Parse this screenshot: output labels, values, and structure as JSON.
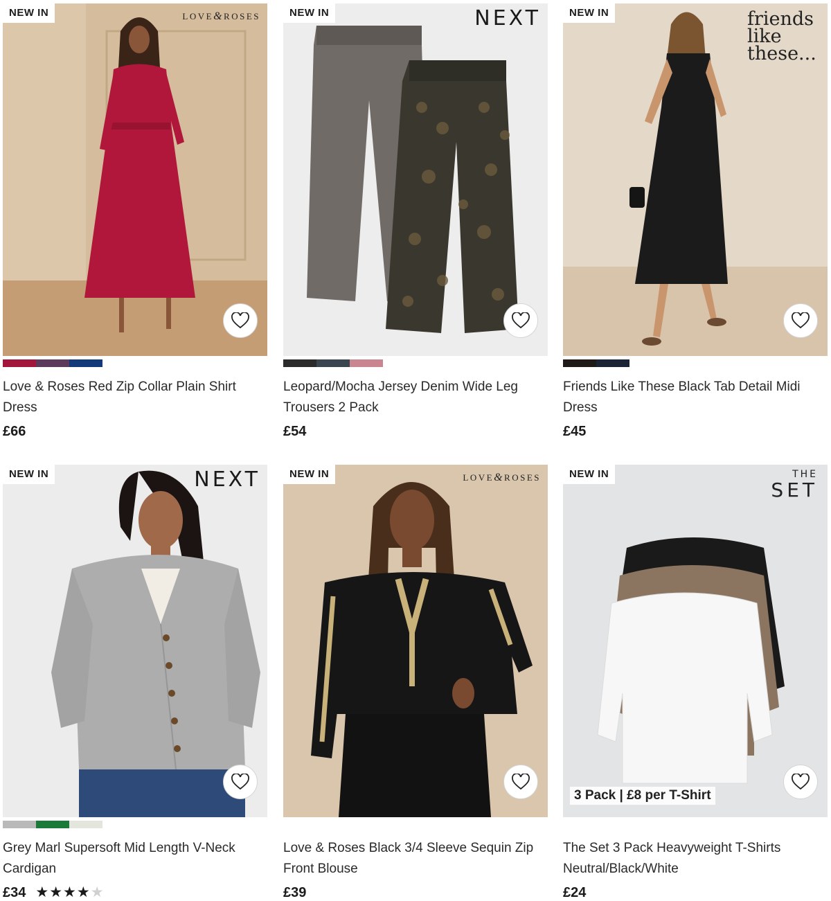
{
  "products": [
    {
      "badge": "NEW IN",
      "brand": "LOVE & ROSES",
      "title": "Love & Roses Red Zip Collar Plain Shirt Dress",
      "price": "£66",
      "swatches": [
        "#a3163c",
        "#5c3a5e",
        "#123a7a"
      ],
      "image_colors": {
        "bg": "#d9c3a6",
        "floor": "#c6a27a",
        "garment": "#b0173a"
      }
    },
    {
      "badge": "NEW IN",
      "brand": "NEXT",
      "title": "Leopard/Mocha Jersey Denim Wide Leg Trousers 2 Pack",
      "price": "£54",
      "swatches": [
        "#2b2b2b",
        "#3a4550",
        "#c98590"
      ],
      "image_colors": {
        "bg": "#ececec",
        "garment": "#6f6a66",
        "garment2": "#3b3a30"
      }
    },
    {
      "badge": "NEW IN",
      "brand": "friends like these...",
      "title": "Friends Like These Black Tab Detail Midi Dress",
      "price": "£45",
      "swatches": [
        "#1f1a18",
        "#1b2436"
      ],
      "image_colors": {
        "bg": "#e3d7c8",
        "floor": "#d8c4ad",
        "garment": "#1b1b1b"
      }
    },
    {
      "badge": "NEW IN",
      "brand": "NEXT",
      "title": "Grey Marl Supersoft Mid Length V-Neck Cardigan",
      "price": "£34",
      "rating": 4,
      "rating_max": 5,
      "swatches": [
        "#b9b9b9",
        "#1b7a3a",
        "#e2e6dd"
      ],
      "image_colors": {
        "bg": "#ececec",
        "garment": "#adadad",
        "jeans": "#2e4a78"
      }
    },
    {
      "badge": "NEW IN",
      "brand": "LOVE & ROSES",
      "title": "Love & Roses Black 3/4 Sleeve Sequin Zip Front Blouse",
      "price": "£39",
      "swatches": [],
      "image_colors": {
        "bg": "#d9c6ad",
        "garment": "#161616",
        "sequin": "#c9b27a"
      }
    },
    {
      "badge": "NEW IN",
      "brand_top": "THE",
      "brand_bottom": "SET",
      "promo": "3 Pack | £8 per T-Shirt",
      "title": "The Set 3 Pack Heavyweight T-Shirts Neutral/Black/White",
      "price": "£24",
      "swatches": [],
      "image_colors": {
        "bg": "#e3e4e6",
        "t1": "#1a1a1a",
        "t2": "#8b7560",
        "t3": "#f7f7f7"
      }
    }
  ],
  "icons": {
    "wishlist": "heart-outline-icon",
    "rating": "star-icon"
  }
}
